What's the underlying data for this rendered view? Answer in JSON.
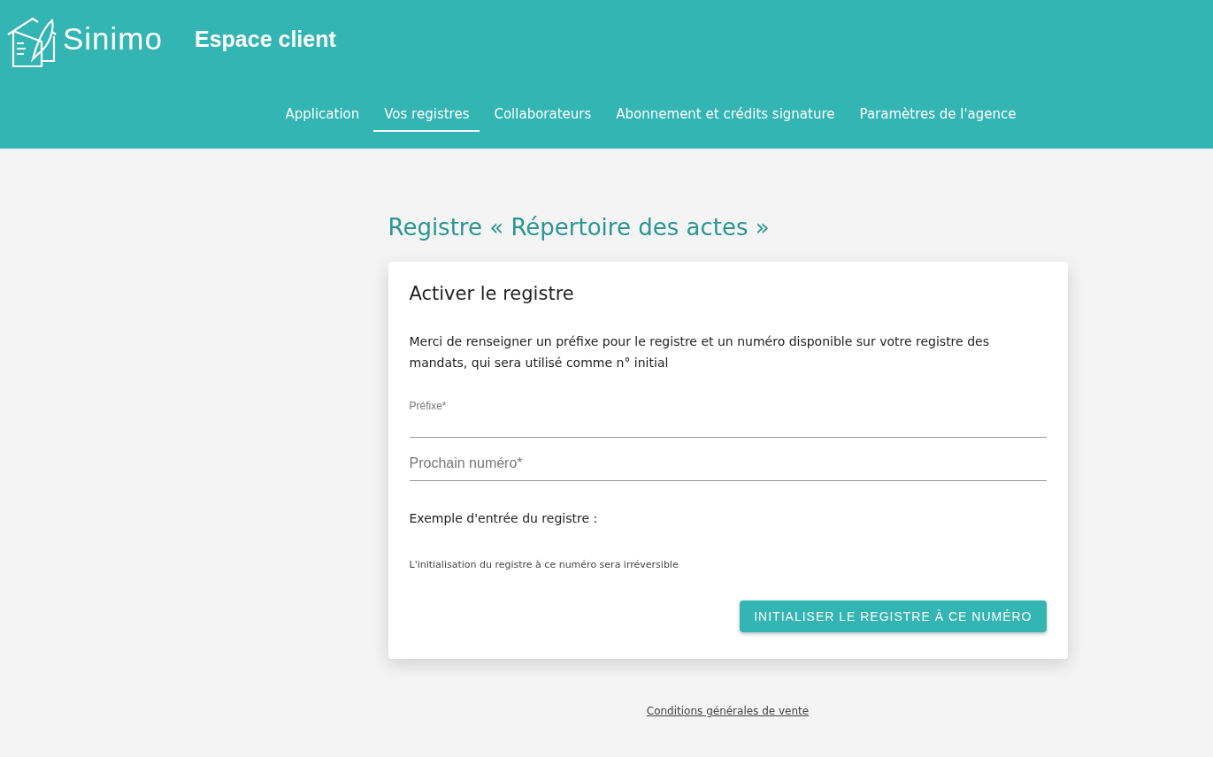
{
  "header": {
    "logo_text": "Sinimo",
    "title": "Espace client"
  },
  "nav": [
    {
      "label": "Application",
      "selected": false
    },
    {
      "label": "Vos registres",
      "selected": true
    },
    {
      "label": "Collaborateurs",
      "selected": false
    },
    {
      "label": "Abonnement et crédits signature",
      "selected": false
    },
    {
      "label": "Paramètres de l'agence",
      "selected": false
    }
  ],
  "page_title": "Registre « Répertoire des actes »",
  "card": {
    "title": "Activer le registre",
    "intro": "Merci de renseigner un préfixe pour le registre et un numéro disponible sur votre registre des mandats, qui sera utilisé comme n° initial",
    "fields": [
      {
        "label": "Préfixe*",
        "floated": true
      },
      {
        "label": "Prochain numéro*",
        "floated": false
      }
    ],
    "example_label": "Exemple d'entrée du registre :",
    "warning": "L'initialisation du registre à ce numéro sera irréversible",
    "button": "INITIALISER LE REGISTRE À CE NUMÉRO"
  },
  "footer_link": "Conditions générales de vente"
}
